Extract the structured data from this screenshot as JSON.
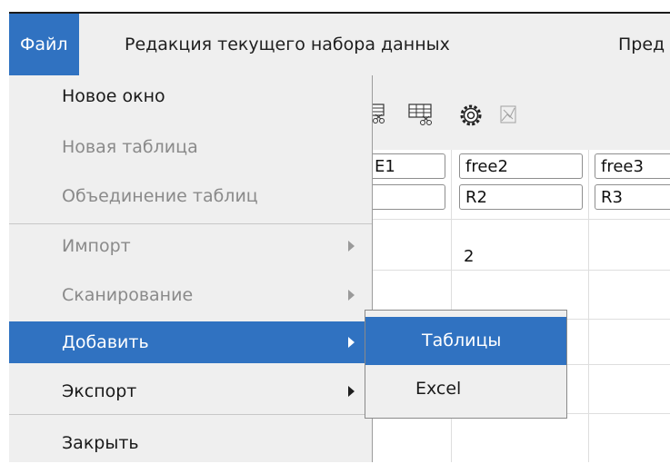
{
  "menubar": {
    "items": [
      {
        "label": "Файл"
      },
      {
        "label": "Редакция текущего набора данных"
      },
      {
        "label": "Пред"
      }
    ]
  },
  "file_menu": {
    "items": [
      {
        "label": "Новое окно",
        "enabled": true,
        "submenu": false
      },
      {
        "label": "Новая таблица",
        "enabled": false,
        "submenu": false
      },
      {
        "label": "Объединение таблиц",
        "enabled": false,
        "submenu": false
      },
      {
        "label": "Импорт",
        "enabled": false,
        "submenu": true
      },
      {
        "label": "Сканирование",
        "enabled": false,
        "submenu": true
      },
      {
        "label": "Добавить",
        "enabled": true,
        "submenu": true,
        "highlighted": true
      },
      {
        "label": "Экспорт",
        "enabled": true,
        "submenu": true
      },
      {
        "label": "Закрыть",
        "enabled": true,
        "submenu": false
      }
    ]
  },
  "add_submenu": {
    "items": [
      {
        "label": "Таблицы",
        "highlighted": true
      },
      {
        "label": "Excel"
      }
    ]
  },
  "table": {
    "header_row1": [
      "E1",
      "free2",
      "free3"
    ],
    "header_row2": [
      "",
      "R2",
      "R3"
    ],
    "row1": [
      "",
      "2",
      ""
    ]
  },
  "toolbar": {
    "icons": [
      "table-cut-icon",
      "table-cut-icon",
      "gear-icon",
      "chart-icon"
    ]
  },
  "colors": {
    "highlight": "#3072c1",
    "menu_bg": "#efefef",
    "disabled_text": "#8a8a8a"
  }
}
